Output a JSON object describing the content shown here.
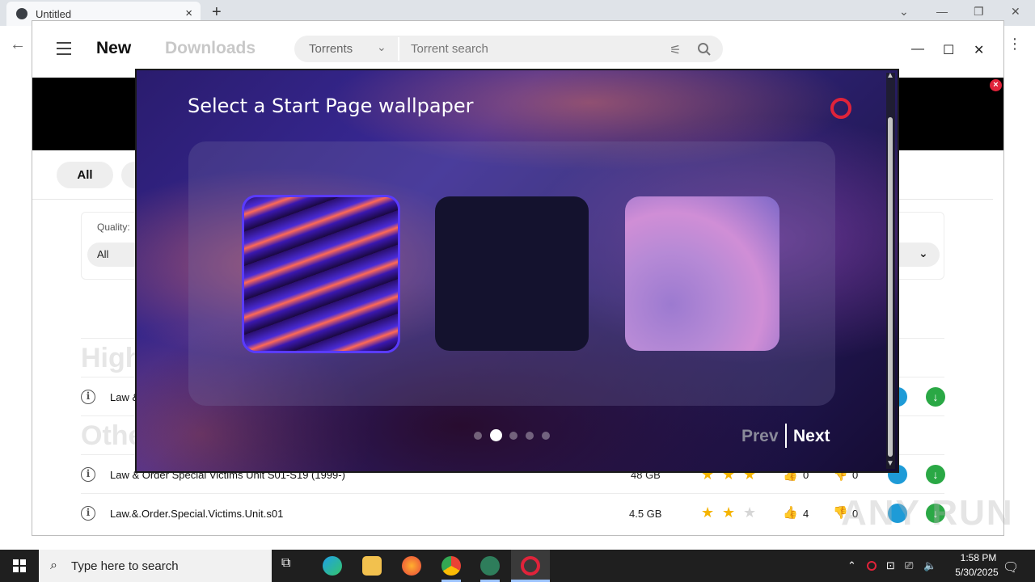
{
  "browser": {
    "tab_title": "Untitled",
    "new_tab_symbol": "+",
    "tab_close_symbol": "×"
  },
  "app": {
    "nav_new": "New",
    "nav_downloads": "Downloads",
    "search_category": "Torrents",
    "search_placeholder": "Torrent search",
    "filter_all": "All",
    "quality_label": "Quality:",
    "quality_value": "All",
    "section_high": "High",
    "section_other": "Other"
  },
  "rows": [
    {
      "title": "Law &",
      "size": "",
      "stars": 0,
      "likes": "",
      "dislikes": ""
    },
    {
      "title": "Law & Order Special Victims Unit S01-S19 (1999-)",
      "size": "48 GB",
      "stars": 3,
      "likes": "0",
      "dislikes": "0"
    },
    {
      "title": "Law.&.Order.Special.Victims.Unit.s01",
      "size": "4.5 GB",
      "stars": 2,
      "likes": "4",
      "dislikes": "0"
    }
  ],
  "modal": {
    "title": "Select a Start Page wallpaper",
    "prev_label": "Prev",
    "next_label": "Next",
    "page_count": 5,
    "active_page": 2
  },
  "taskbar": {
    "search_placeholder": "Type here to search",
    "time": "1:58 PM",
    "date": "5/30/2025"
  },
  "watermark": "ANY RUN",
  "colors": {
    "accent_red": "#e0233a",
    "selected_border": "#5a3bff",
    "download_green": "#2aa845",
    "play_blue": "#1e9bd7"
  }
}
